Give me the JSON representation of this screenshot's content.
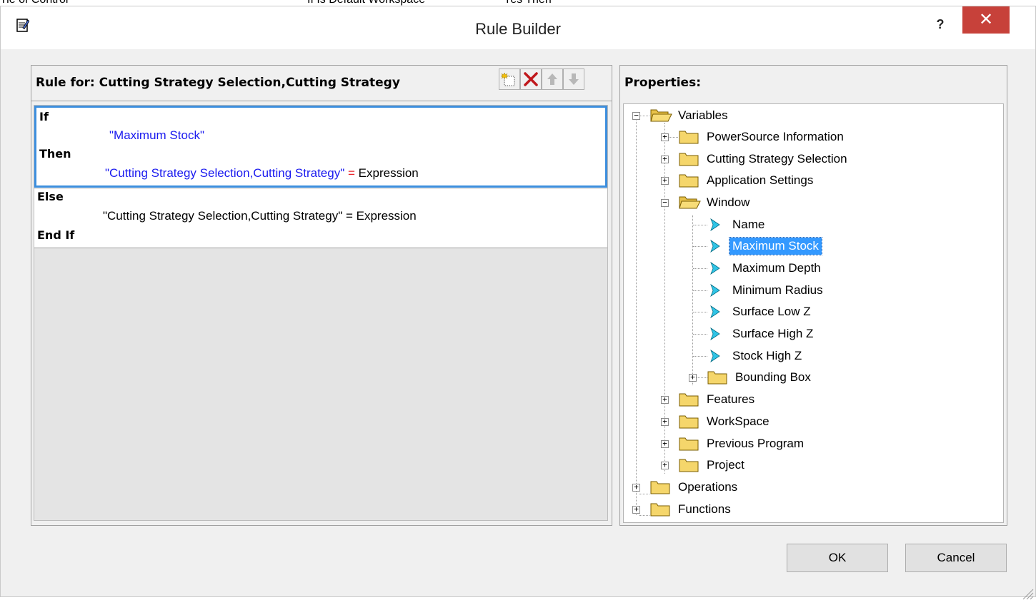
{
  "background": {
    "texts": [
      "Tie of Control",
      "If Is Default Workspace",
      "Yes Then"
    ]
  },
  "window": {
    "title": "Rule Builder",
    "help_label": "?",
    "close_label": "✕"
  },
  "rule_panel": {
    "header": "Rule for: Cutting Strategy Selection,Cutting Strategy",
    "toolbar": [
      "new-rule-icon",
      "delete-icon",
      "move-up-icon",
      "move-down-icon"
    ],
    "if_keyword": "If",
    "condition": "\"Maximum Stock\"",
    "then_keyword": "Then",
    "then_target": "\"Cutting Strategy Selection,Cutting Strategy\"",
    "then_operator": "=",
    "then_value": "Expression",
    "else_keyword": "Else",
    "else_statement": "\"Cutting Strategy Selection,Cutting Strategy\" = Expression",
    "end_keyword": "End If"
  },
  "properties_panel": {
    "header": "Properties:",
    "tree": {
      "root": "Variables",
      "children": [
        "PowerSource Information",
        "Cutting Strategy Selection",
        "Application Settings",
        "Window",
        "Features",
        "WorkSpace",
        "Previous Program",
        "Project"
      ],
      "window_children": [
        "Name",
        "Maximum Stock",
        "Maximum Depth",
        "Minimum Radius",
        "Surface Low Z",
        "Surface High Z",
        "Stock High Z",
        "Bounding Box"
      ],
      "selected": "Maximum Stock",
      "other_roots": [
        "Operations",
        "Functions"
      ]
    }
  },
  "buttons": {
    "ok": "OK",
    "cancel": "Cancel"
  },
  "colors": {
    "accent_selection": "#3399ff",
    "rule_border": "#3d8fde",
    "close_button": "#c7413a",
    "code_blue": "#1a1aef",
    "operator_red": "#e8232a",
    "folder_yellow": "#f5d66b",
    "variable_cyan": "#2ec4e6"
  }
}
